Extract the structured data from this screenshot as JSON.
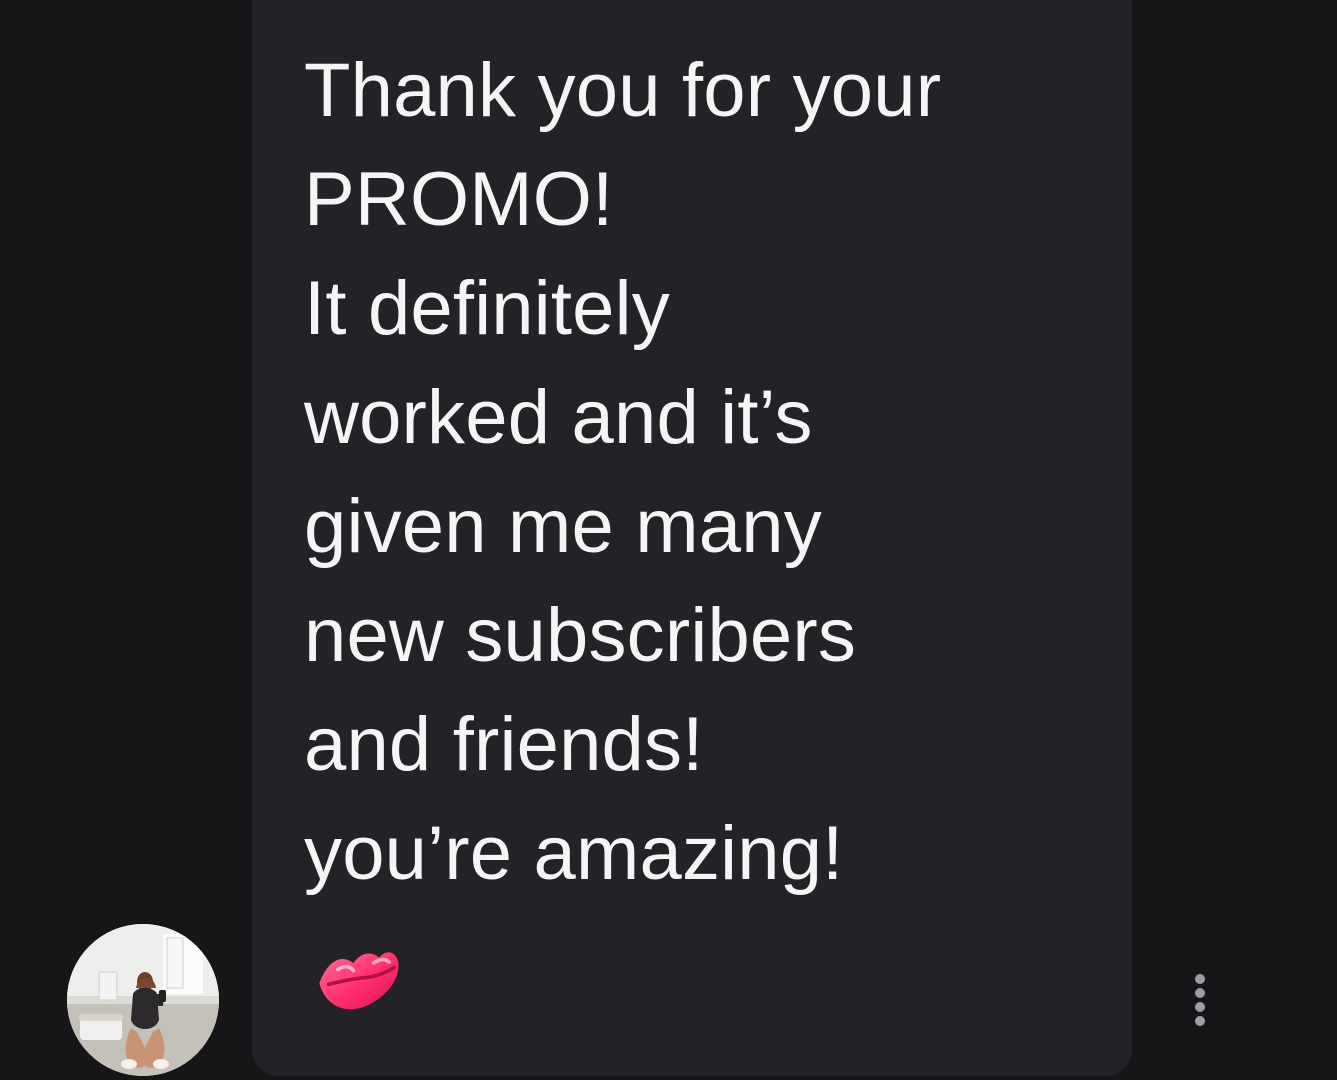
{
  "message": {
    "lines": [
      "Thank you for your",
      "PROMO!",
      "It definitely",
      "worked and it’s",
      "given me many",
      "new subscribers",
      "and friends!",
      "you’re amazing!"
    ],
    "emoji_icon": "kiss-mark-icon"
  },
  "avatar": {
    "icon": "profile-photo-avatar"
  },
  "actions": {
    "more_icon": "more-vertical-icon"
  },
  "colors": {
    "background": "#161618",
    "bubble": "#232327",
    "text": "#f5f5f5",
    "accent": "#ff2d6f",
    "menu_dots": "#9d9da2"
  }
}
